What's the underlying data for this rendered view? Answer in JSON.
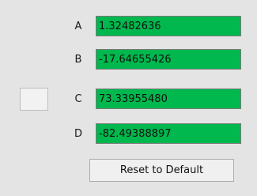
{
  "swatch": {
    "color": "#f2f2f2"
  },
  "rows": [
    {
      "label": "A",
      "value": "1.32482636"
    },
    {
      "label": "B",
      "value": "-17.64655426"
    },
    {
      "label": "C",
      "value": "73.33955480"
    },
    {
      "label": "D",
      "value": "-82.49388897"
    }
  ],
  "colors": {
    "field_background": "#00b84d",
    "panel_background": "#e4e4e4"
  },
  "reset_label": "Reset to Default"
}
